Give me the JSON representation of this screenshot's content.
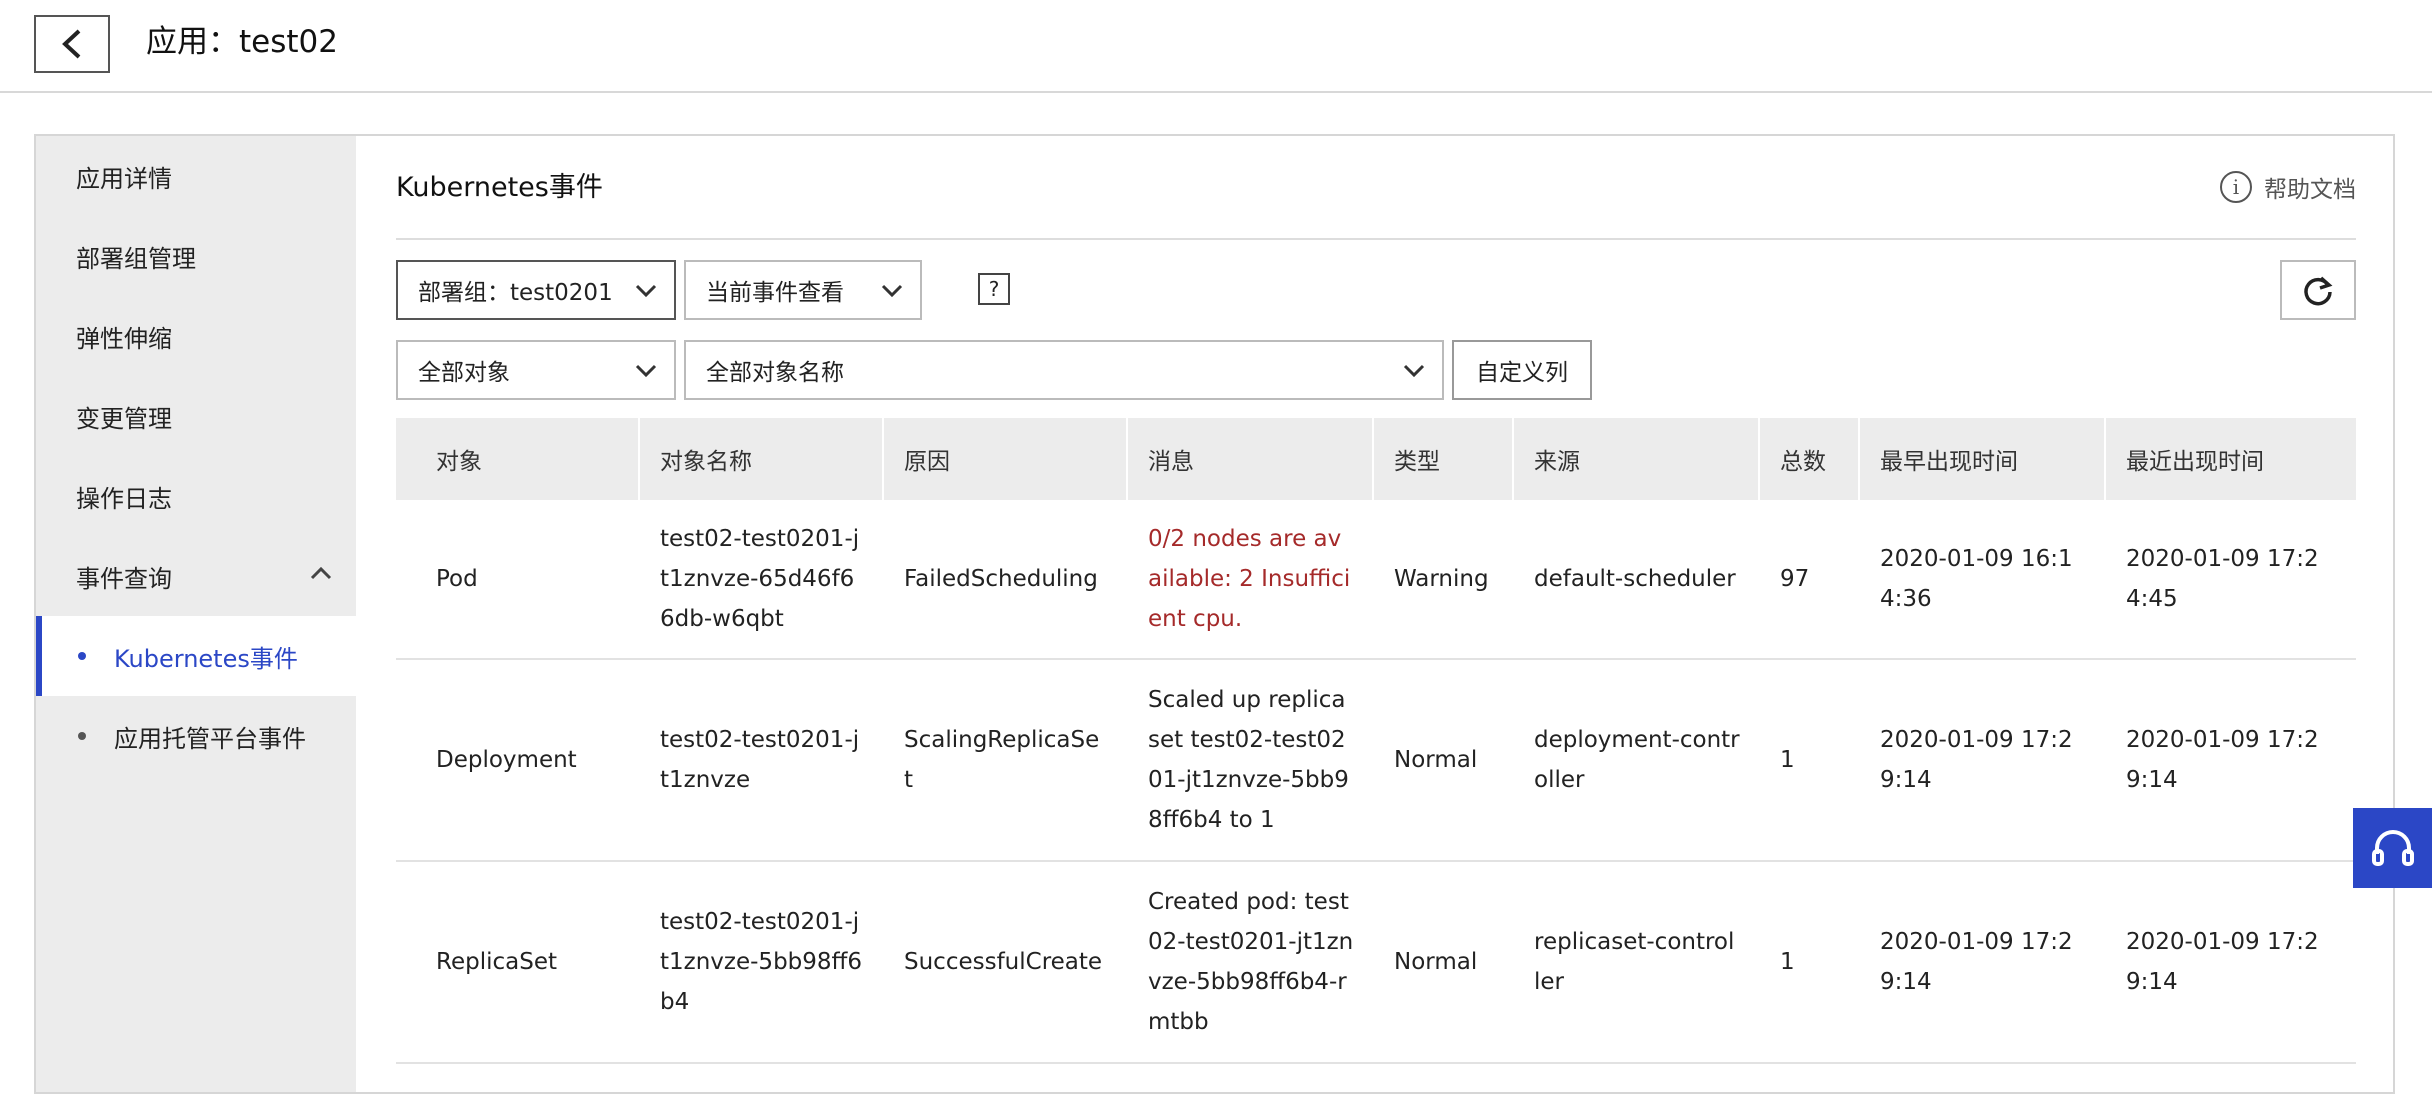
{
  "header": {
    "title": "应用：test02"
  },
  "sidebar": {
    "items": [
      {
        "label": "应用详情"
      },
      {
        "label": "部署组管理"
      },
      {
        "label": "弹性伸缩"
      },
      {
        "label": "变更管理"
      },
      {
        "label": "操作日志"
      },
      {
        "label": "事件查询"
      }
    ],
    "subitems": [
      {
        "label": "Kubernetes事件",
        "active": true
      },
      {
        "label": "应用托管平台事件",
        "active": false
      }
    ]
  },
  "main": {
    "title": "Kubernetes事件",
    "help_label": "帮助文档",
    "filters": {
      "group": "部署组：test0201",
      "event_view": "当前事件查看",
      "object": "全部对象",
      "object_name": "全部对象名称",
      "help_mark": "?",
      "custom_columns": "自定义列"
    },
    "table": {
      "headers": [
        "对象",
        "对象名称",
        "原因",
        "消息",
        "类型",
        "来源",
        "总数",
        "最早出现时间",
        "最近出现时间"
      ],
      "rows": [
        [
          "Pod",
          "test02-test0201-jt1znvze-65d46f66db-w6qbt",
          "FailedScheduling",
          "0/2 nodes are available: 2 Insufficient cpu.",
          "Warning",
          "default-scheduler",
          "97",
          "2020-01-09 16:14:36",
          "2020-01-09 17:24:45"
        ],
        [
          "Deployment",
          "test02-test0201-jt1znvze",
          "ScalingReplicaSet",
          "Scaled up replica set test02-test0201-jt1znvze-5bb98ff6b4 to 1",
          "Normal",
          "deployment-controller",
          "1",
          "2020-01-09 17:29:14",
          "2020-01-09 17:29:14"
        ],
        [
          "ReplicaSet",
          "test02-test0201-jt1znvze-5bb98ff6b4",
          "SuccessfulCreate",
          "Created pod: test02-test0201-jt1znvze-5bb98ff6b4-rmtbb",
          "Normal",
          "replicaset-controller",
          "1",
          "2020-01-09 17:29:14",
          "2020-01-09 17:29:14"
        ]
      ]
    }
  },
  "colors": {
    "accent": "#2b47c6",
    "warning": "#a52a2a",
    "sidebar_bg": "#ececec"
  },
  "icons": [
    "chevron-left-icon",
    "chevron-down-icon",
    "chevron-up-icon",
    "info-icon",
    "refresh-icon",
    "headset-icon"
  ]
}
